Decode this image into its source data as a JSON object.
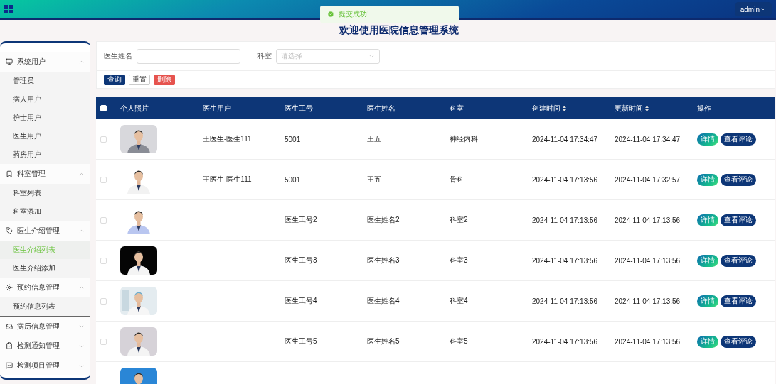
{
  "header": {
    "user": "admin"
  },
  "toast": {
    "message": "提交成功!"
  },
  "title": "欢迎使用医院信息管理系统",
  "sidebar": {
    "groups": [
      {
        "label": "系统用户",
        "expanded": true,
        "children": [
          {
            "label": "管理员",
            "selected": false
          },
          {
            "label": "病人用户",
            "selected": false
          },
          {
            "label": "护士用户",
            "selected": false
          },
          {
            "label": "医生用户",
            "selected": false
          },
          {
            "label": "药房用户",
            "selected": false
          }
        ]
      },
      {
        "label": "科室管理",
        "expanded": true,
        "children": [
          {
            "label": "科室列表",
            "selected": false
          },
          {
            "label": "科室添加",
            "selected": false
          }
        ]
      },
      {
        "label": "医生介绍管理",
        "expanded": true,
        "children": [
          {
            "label": "医生介绍列表",
            "selected": true
          },
          {
            "label": "医生介绍添加",
            "selected": false
          }
        ]
      },
      {
        "label": "预约信息管理",
        "expanded": true,
        "children": [
          {
            "label": "预约信息列表",
            "selected": false
          }
        ]
      },
      {
        "label": "病历信息管理",
        "expanded": false
      },
      {
        "label": "检测通知管理",
        "expanded": false
      },
      {
        "label": "检测项目管理",
        "expanded": false
      }
    ]
  },
  "search": {
    "fields": [
      {
        "label": "医生姓名",
        "kind": "input"
      },
      {
        "label": "科室",
        "kind": "select",
        "placeholder": "请选择"
      }
    ],
    "buttons": [
      {
        "label": "查询",
        "kind": "primary"
      },
      {
        "label": "重置",
        "kind": "plain"
      },
      {
        "label": "删除",
        "kind": "danger"
      }
    ]
  },
  "table": {
    "select_all": {
      "checked": false
    },
    "columns": [
      {
        "label": "个人照片",
        "sortable": false
      },
      {
        "label": "医生用户",
        "sortable": false
      },
      {
        "label": "医生工号",
        "sortable": false
      },
      {
        "label": "医生姓名",
        "sortable": false
      },
      {
        "label": "科室",
        "sortable": false
      },
      {
        "label": "创建时间",
        "sortable": true
      },
      {
        "label": "更新时间",
        "sortable": true
      },
      {
        "label": "操作",
        "sortable": false
      }
    ],
    "rows": [
      {
        "kind": "picture",
        "checked": false,
        "user": "王医生-医生111",
        "staff_no": "5001",
        "name": "王五",
        "department": "神经内科",
        "created": "2024-11-04 17:34:47",
        "updated": "2024-11-04 17:34:47",
        "actions": [
          "详情",
          "查看评论"
        ]
      },
      {
        "kind": "picture",
        "checked": false,
        "user": "王医生-医生111",
        "staff_no": "5001",
        "name": "王五",
        "department": "骨科",
        "created": "2024-11-04 17:13:56",
        "updated": "2024-11-04 17:32:57",
        "actions": [
          "详情",
          "查看评论"
        ]
      },
      {
        "kind": "picture",
        "checked": false,
        "staff_no": "医生工号2",
        "name": "医生姓名2",
        "department": "科室2",
        "created": "2024-11-04 17:13:56",
        "updated": "2024-11-04 17:13:56",
        "actions": [
          "详情",
          "查看评论"
        ]
      },
      {
        "kind": "picture",
        "checked": false,
        "staff_no": "医生工号3",
        "name": "医生姓名3",
        "department": "科室3",
        "created": "2024-11-04 17:13:56",
        "updated": "2024-11-04 17:13:56",
        "actions": [
          "详情",
          "查看评论"
        ]
      },
      {
        "kind": "picture",
        "checked": false,
        "staff_no": "医生工号4",
        "name": "医生姓名4",
        "department": "科室4",
        "created": "2024-11-04 17:13:56",
        "updated": "2024-11-04 17:13:56",
        "actions": [
          "详情",
          "查看评论"
        ]
      },
      {
        "kind": "picture",
        "checked": false,
        "staff_no": "医生工号5",
        "name": "医生姓名5",
        "department": "科室5",
        "created": "2024-11-04 17:13:56",
        "updated": "2024-11-04 17:13:56",
        "actions": [
          "详情",
          "查看评论"
        ]
      },
      {
        "kind": "picture"
      }
    ]
  }
}
